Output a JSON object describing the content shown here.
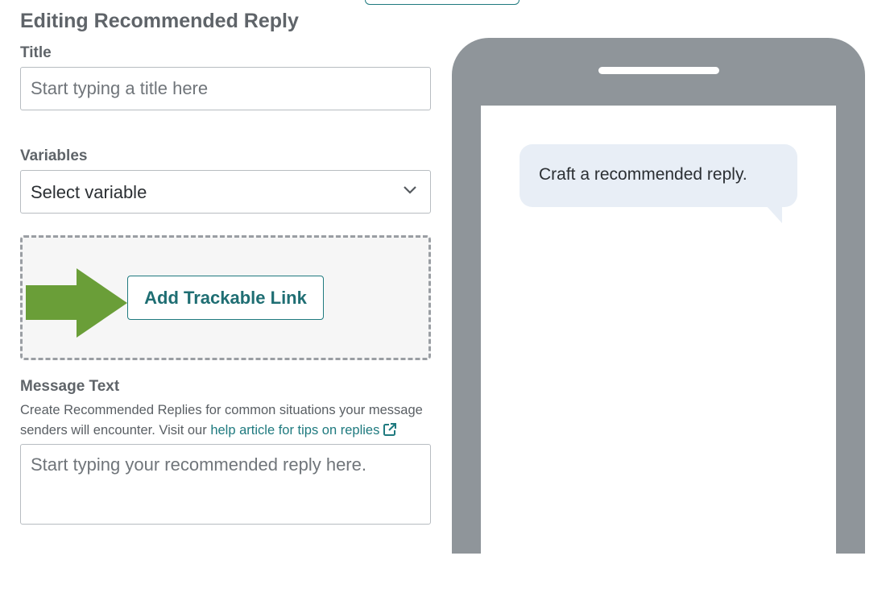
{
  "page": {
    "title": "Editing Recommended Reply"
  },
  "form": {
    "title_label": "Title",
    "title_placeholder": "Start typing a title here",
    "variables_label": "Variables",
    "variables_selected": "Select variable",
    "add_link_button": "Add Trackable Link",
    "message_label": "Message Text",
    "message_help_prefix": "Create Recommended Replies for common situations your message senders will encounter. Visit our ",
    "message_help_link": "help article for tips on replies",
    "message_placeholder": "Start typing your recommended reply here."
  },
  "preview": {
    "bubble_text": "Craft a recommended reply."
  },
  "icons": {
    "dropdown": "chevron-down-icon",
    "external": "external-link-icon",
    "arrow": "green-arrow"
  },
  "colors": {
    "accent": "#1f7a7f",
    "arrow": "#6a9e38",
    "phone_frame": "#8f959a",
    "bubble": "#e8eef6"
  }
}
